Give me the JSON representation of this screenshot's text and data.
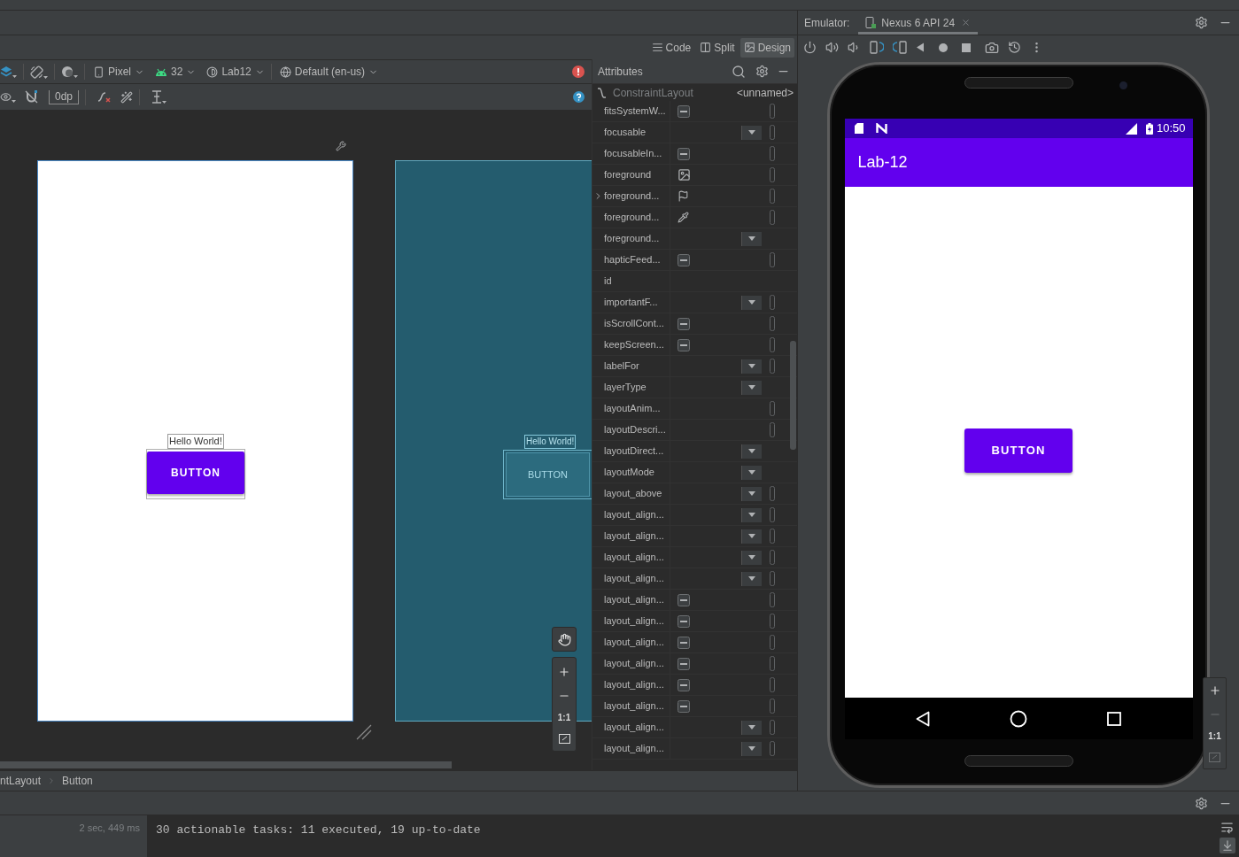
{
  "editor": {
    "view_modes": [
      {
        "label": "Code",
        "selected": false
      },
      {
        "label": "Split",
        "selected": false
      },
      {
        "label": "Design",
        "selected": true
      }
    ],
    "toolbar": {
      "device": "Pixel",
      "api": "32",
      "theme": "Lab12",
      "locale": "Default (en-us)",
      "margin": "0dp"
    },
    "canvas": {
      "design_label": "Hello World!",
      "design_button": "BUTTON",
      "blueprint_label": "Hello World!",
      "blueprint_button": "BUTTON",
      "zoom_reset": "1:1"
    },
    "breadcrumb": [
      "ntLayout",
      "Button"
    ]
  },
  "attributes": {
    "title": "Attributes",
    "layout": "ConstraintLayout",
    "layout_name": "<unnamed>",
    "rows": [
      {
        "name": "fitsSystemW...",
        "kind": "checkbox",
        "picker": true,
        "expandable": false
      },
      {
        "name": "focusable",
        "kind": "dropdown",
        "picker": true,
        "expandable": false
      },
      {
        "name": "focusableIn...",
        "kind": "checkbox",
        "picker": true,
        "expandable": false
      },
      {
        "name": "foreground",
        "kind": "image",
        "picker": true,
        "expandable": false
      },
      {
        "name": "foreground...",
        "kind": "flag",
        "picker": true,
        "expandable": true
      },
      {
        "name": "foreground...",
        "kind": "color",
        "picker": true,
        "expandable": false
      },
      {
        "name": "foreground...",
        "kind": "dropdown",
        "picker": false,
        "expandable": false
      },
      {
        "name": "hapticFeed...",
        "kind": "checkbox",
        "picker": true,
        "expandable": false
      },
      {
        "name": "id",
        "kind": "text",
        "picker": false,
        "expandable": false
      },
      {
        "name": "importantF...",
        "kind": "dropdown",
        "picker": true,
        "expandable": false
      },
      {
        "name": "isScrollCont...",
        "kind": "checkbox",
        "picker": true,
        "expandable": false
      },
      {
        "name": "keepScreen...",
        "kind": "checkbox",
        "picker": true,
        "expandable": false
      },
      {
        "name": "labelFor",
        "kind": "dropdown",
        "picker": true,
        "expandable": false
      },
      {
        "name": "layerType",
        "kind": "dropdown",
        "picker": false,
        "expandable": false
      },
      {
        "name": "layoutAnim...",
        "kind": "text",
        "picker": true,
        "expandable": false
      },
      {
        "name": "layoutDescri...",
        "kind": "text",
        "picker": true,
        "expandable": false
      },
      {
        "name": "layoutDirect...",
        "kind": "dropdown",
        "picker": false,
        "expandable": false
      },
      {
        "name": "layoutMode",
        "kind": "dropdown",
        "picker": false,
        "expandable": false
      },
      {
        "name": "layout_above",
        "kind": "dropdown",
        "picker": true,
        "expandable": false
      },
      {
        "name": "layout_align...",
        "kind": "dropdown",
        "picker": true,
        "expandable": false
      },
      {
        "name": "layout_align...",
        "kind": "dropdown",
        "picker": true,
        "expandable": false
      },
      {
        "name": "layout_align...",
        "kind": "dropdown",
        "picker": true,
        "expandable": false
      },
      {
        "name": "layout_align...",
        "kind": "dropdown",
        "picker": true,
        "expandable": false
      },
      {
        "name": "layout_align...",
        "kind": "checkbox",
        "picker": true,
        "expandable": false
      },
      {
        "name": "layout_align...",
        "kind": "checkbox",
        "picker": true,
        "expandable": false
      },
      {
        "name": "layout_align...",
        "kind": "checkbox",
        "picker": true,
        "expandable": false
      },
      {
        "name": "layout_align...",
        "kind": "checkbox",
        "picker": true,
        "expandable": false
      },
      {
        "name": "layout_align...",
        "kind": "checkbox",
        "picker": true,
        "expandable": false
      },
      {
        "name": "layout_align...",
        "kind": "checkbox",
        "picker": true,
        "expandable": false
      },
      {
        "name": "layout_align...",
        "kind": "dropdown",
        "picker": true,
        "expandable": false
      },
      {
        "name": "layout_align...",
        "kind": "dropdown",
        "picker": true,
        "expandable": false
      }
    ]
  },
  "emulator": {
    "label": "Emulator:",
    "tab": "Nexus 6 API 24",
    "time": "10:50",
    "app_title": "Lab-12",
    "button": "BUTTON",
    "zoom_reset": "1:1"
  },
  "build_output": {
    "duration": "2 sec, 449 ms",
    "message": "30 actionable tasks: 11 executed, 19 up-to-date"
  }
}
